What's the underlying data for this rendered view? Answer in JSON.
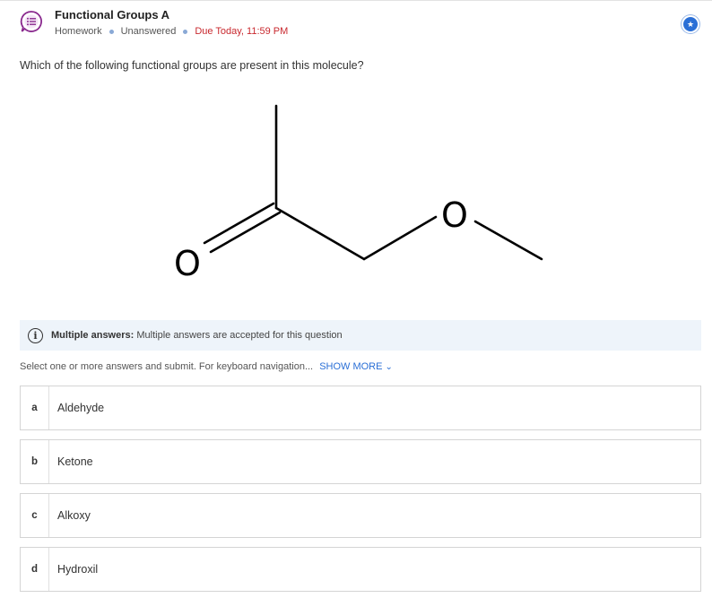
{
  "header": {
    "title": "Functional Groups A",
    "type": "Homework",
    "status": "Unanswered",
    "due": "Due Today, 11:59 PM",
    "icons": {
      "question": "question-list-icon",
      "favorite": "star-icon"
    }
  },
  "question": {
    "prompt": "Which of the following functional groups are present in this molecule?",
    "molecule_labels": {
      "carbonyl_oxygen": "O",
      "ether_oxygen": "O"
    }
  },
  "info": {
    "icon": "info-icon",
    "label": "Multiple answers:",
    "text": "Multiple answers are accepted for this question"
  },
  "instructions": {
    "text": "Select one or more answers and submit. For keyboard navigation...",
    "show_more": "SHOW MORE"
  },
  "answers": [
    {
      "letter": "a",
      "text": "Aldehyde"
    },
    {
      "letter": "b",
      "text": "Ketone"
    },
    {
      "letter": "c",
      "text": "Alkoxy"
    },
    {
      "letter": "d",
      "text": "Hydroxil"
    }
  ],
  "colors": {
    "due": "#c8282e",
    "link": "#2a6fd6",
    "info_bg": "#eef4fa",
    "icon_purple": "#8a2a8e"
  }
}
